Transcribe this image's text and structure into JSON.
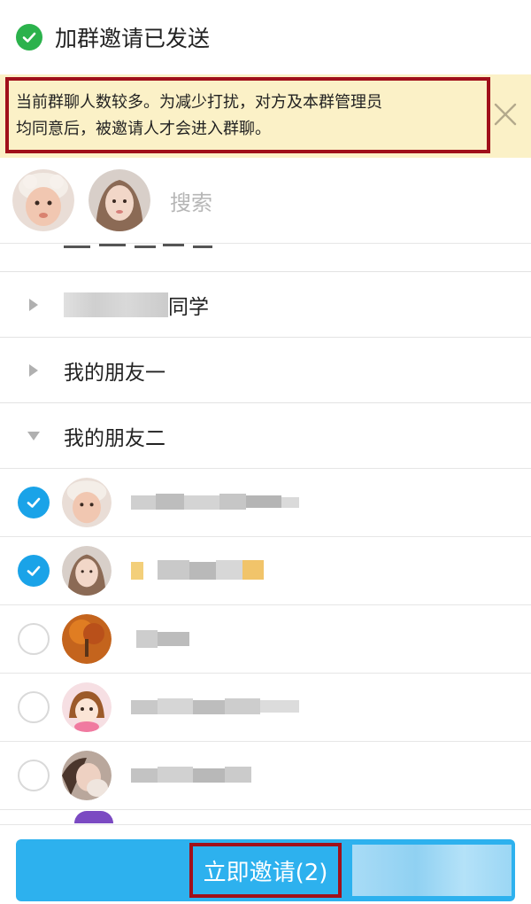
{
  "toast": {
    "icon": "check-circle-icon",
    "text": "加群邀请已发送"
  },
  "notice": {
    "line1": "当前群聊人数较多。为减少打扰，对方及本群管理员",
    "line2": "均同意后，被邀请人才会进入群聊。",
    "close_icon": "close-icon",
    "background": "#fbf1c7",
    "highlight_color": "#a0101a"
  },
  "selected_bar": {
    "avatars": [
      "baby-avatar",
      "girl-avatar"
    ],
    "search_placeholder": "搜索"
  },
  "groups": [
    {
      "label_visible": "同学",
      "expanded": false
    },
    {
      "label": "我的朋友一",
      "expanded": false
    },
    {
      "label": "我的朋友二",
      "expanded": true
    }
  ],
  "contacts": [
    {
      "checked": true,
      "avatar": "baby-avatar"
    },
    {
      "checked": true,
      "avatar": "girl-avatar"
    },
    {
      "checked": false,
      "avatar": "autumn-tree-avatar"
    },
    {
      "checked": false,
      "avatar": "cartoon-girl-avatar"
    },
    {
      "checked": false,
      "avatar": "couple-avatar"
    }
  ],
  "footer": {
    "button_label": "立即邀请(2)",
    "button_color": "#2db1ee"
  }
}
